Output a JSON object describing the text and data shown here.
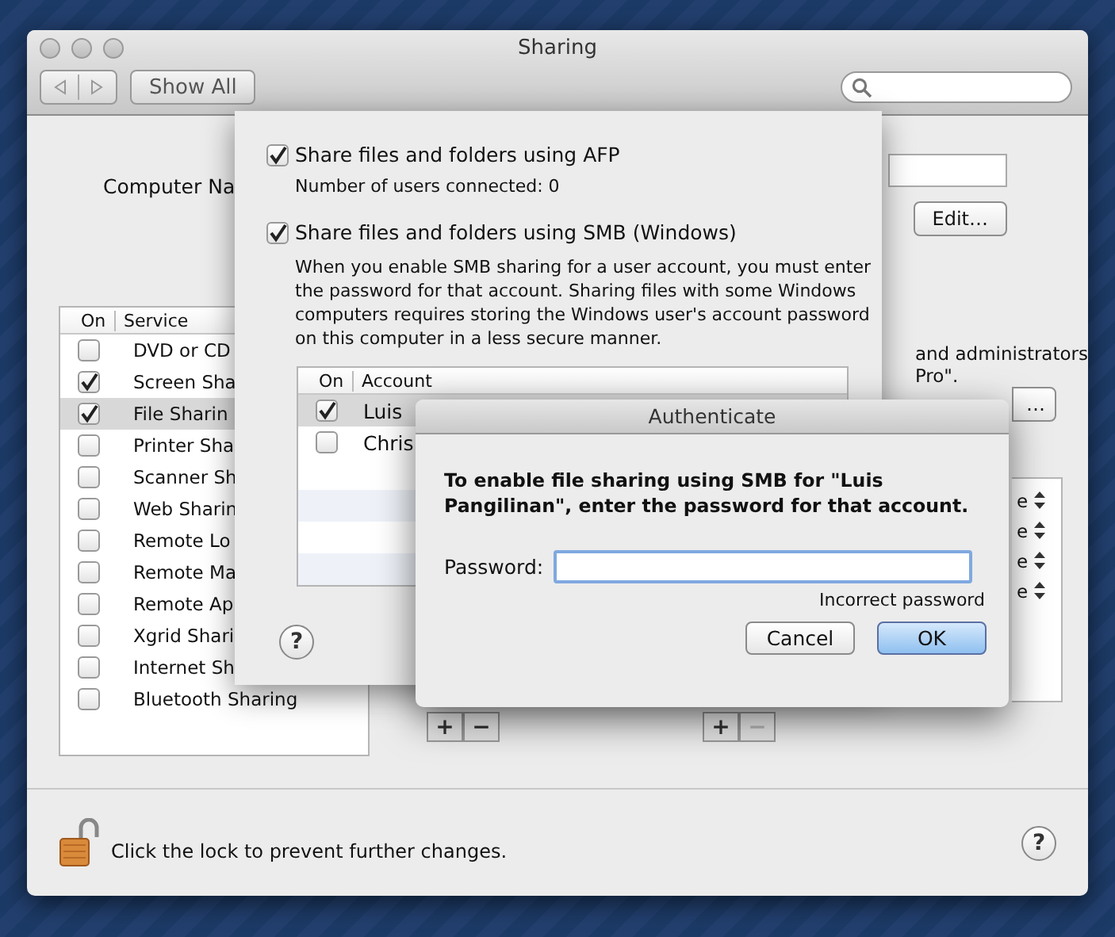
{
  "window": {
    "title": "Sharing"
  },
  "toolbar": {
    "show_all": "Show All"
  },
  "computer_name": {
    "label": "Computer Na",
    "edit_button": "Edit…"
  },
  "services": {
    "columns": [
      "On",
      "Service"
    ],
    "items": [
      {
        "name": "DVD or CD",
        "checked": false,
        "selected": false
      },
      {
        "name": "Screen Sha",
        "checked": true,
        "selected": false
      },
      {
        "name": "File Sharin",
        "checked": true,
        "selected": true
      },
      {
        "name": "Printer Sha",
        "checked": false,
        "selected": false
      },
      {
        "name": "Scanner Sh",
        "checked": false,
        "selected": false
      },
      {
        "name": "Web Sharin",
        "checked": false,
        "selected": false
      },
      {
        "name": "Remote Lo",
        "checked": false,
        "selected": false
      },
      {
        "name": "Remote Ma",
        "checked": false,
        "selected": false
      },
      {
        "name": "Remote Ap",
        "checked": false,
        "selected": false
      },
      {
        "name": "Xgrid Shari",
        "checked": false,
        "selected": false
      },
      {
        "name": "Internet Sh",
        "checked": false,
        "selected": false
      },
      {
        "name": "Bluetooth Sharing",
        "checked": false,
        "selected": false
      }
    ]
  },
  "right_panel": {
    "text_lines": [
      "and administrators",
      "Pro\"."
    ],
    "button": "…",
    "access_rows": [
      "e",
      "e",
      "e",
      "e"
    ]
  },
  "list_buttons": [
    [
      {
        "label": "+",
        "disabled": false
      },
      {
        "label": "−",
        "disabled": false
      }
    ],
    [
      {
        "label": "+",
        "disabled": false
      },
      {
        "label": "−",
        "disabled": true
      }
    ]
  ],
  "sheet": {
    "options": [
      {
        "label": "Share files and folders using AFP",
        "checked": true,
        "note": "Number of users connected: 0"
      },
      {
        "label": "Share files and folders using SMB (Windows)",
        "checked": true,
        "note": "When you enable SMB sharing for a user account, you must enter the password for that account. Sharing files with some Windows computers requires storing the Windows user's account password on this computer in a less secure manner."
      }
    ],
    "accounts": {
      "columns": [
        "On",
        "Account"
      ],
      "rows": [
        {
          "name": "Luis",
          "checked": true,
          "selected": true
        },
        {
          "name": "Chris",
          "checked": false,
          "selected": false
        }
      ]
    },
    "help": "?"
  },
  "dialog": {
    "title": "Authenticate",
    "message": "To enable file sharing using SMB for \"Luis Pangilinan\", enter the password for that account.",
    "password_label": "Password:",
    "error": "Incorrect password",
    "buttons": [
      {
        "label": "Cancel",
        "default": false
      },
      {
        "label": "OK",
        "default": true
      }
    ]
  },
  "footer": {
    "lock_text": "Click the lock to prevent further changes.",
    "help": "?"
  }
}
